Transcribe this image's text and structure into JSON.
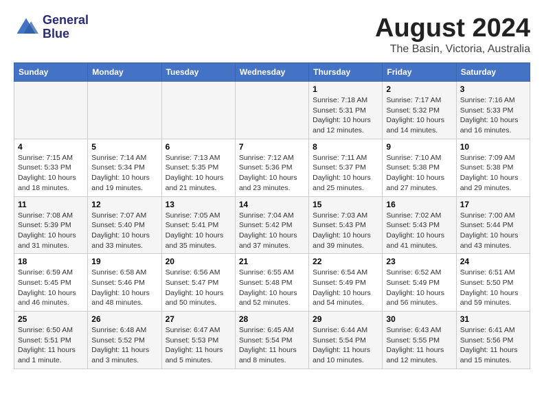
{
  "header": {
    "logo_line1": "General",
    "logo_line2": "Blue",
    "main_title": "August 2024",
    "subtitle": "The Basin, Victoria, Australia"
  },
  "columns": [
    "Sunday",
    "Monday",
    "Tuesday",
    "Wednesday",
    "Thursday",
    "Friday",
    "Saturday"
  ],
  "weeks": [
    [
      {
        "day": "",
        "info": ""
      },
      {
        "day": "",
        "info": ""
      },
      {
        "day": "",
        "info": ""
      },
      {
        "day": "",
        "info": ""
      },
      {
        "day": "1",
        "info": "Sunrise: 7:18 AM\nSunset: 5:31 PM\nDaylight: 10 hours\nand 12 minutes."
      },
      {
        "day": "2",
        "info": "Sunrise: 7:17 AM\nSunset: 5:32 PM\nDaylight: 10 hours\nand 14 minutes."
      },
      {
        "day": "3",
        "info": "Sunrise: 7:16 AM\nSunset: 5:33 PM\nDaylight: 10 hours\nand 16 minutes."
      }
    ],
    [
      {
        "day": "4",
        "info": "Sunrise: 7:15 AM\nSunset: 5:33 PM\nDaylight: 10 hours\nand 18 minutes."
      },
      {
        "day": "5",
        "info": "Sunrise: 7:14 AM\nSunset: 5:34 PM\nDaylight: 10 hours\nand 19 minutes."
      },
      {
        "day": "6",
        "info": "Sunrise: 7:13 AM\nSunset: 5:35 PM\nDaylight: 10 hours\nand 21 minutes."
      },
      {
        "day": "7",
        "info": "Sunrise: 7:12 AM\nSunset: 5:36 PM\nDaylight: 10 hours\nand 23 minutes."
      },
      {
        "day": "8",
        "info": "Sunrise: 7:11 AM\nSunset: 5:37 PM\nDaylight: 10 hours\nand 25 minutes."
      },
      {
        "day": "9",
        "info": "Sunrise: 7:10 AM\nSunset: 5:38 PM\nDaylight: 10 hours\nand 27 minutes."
      },
      {
        "day": "10",
        "info": "Sunrise: 7:09 AM\nSunset: 5:38 PM\nDaylight: 10 hours\nand 29 minutes."
      }
    ],
    [
      {
        "day": "11",
        "info": "Sunrise: 7:08 AM\nSunset: 5:39 PM\nDaylight: 10 hours\nand 31 minutes."
      },
      {
        "day": "12",
        "info": "Sunrise: 7:07 AM\nSunset: 5:40 PM\nDaylight: 10 hours\nand 33 minutes."
      },
      {
        "day": "13",
        "info": "Sunrise: 7:05 AM\nSunset: 5:41 PM\nDaylight: 10 hours\nand 35 minutes."
      },
      {
        "day": "14",
        "info": "Sunrise: 7:04 AM\nSunset: 5:42 PM\nDaylight: 10 hours\nand 37 minutes."
      },
      {
        "day": "15",
        "info": "Sunrise: 7:03 AM\nSunset: 5:43 PM\nDaylight: 10 hours\nand 39 minutes."
      },
      {
        "day": "16",
        "info": "Sunrise: 7:02 AM\nSunset: 5:43 PM\nDaylight: 10 hours\nand 41 minutes."
      },
      {
        "day": "17",
        "info": "Sunrise: 7:00 AM\nSunset: 5:44 PM\nDaylight: 10 hours\nand 43 minutes."
      }
    ],
    [
      {
        "day": "18",
        "info": "Sunrise: 6:59 AM\nSunset: 5:45 PM\nDaylight: 10 hours\nand 46 minutes."
      },
      {
        "day": "19",
        "info": "Sunrise: 6:58 AM\nSunset: 5:46 PM\nDaylight: 10 hours\nand 48 minutes."
      },
      {
        "day": "20",
        "info": "Sunrise: 6:56 AM\nSunset: 5:47 PM\nDaylight: 10 hours\nand 50 minutes."
      },
      {
        "day": "21",
        "info": "Sunrise: 6:55 AM\nSunset: 5:48 PM\nDaylight: 10 hours\nand 52 minutes."
      },
      {
        "day": "22",
        "info": "Sunrise: 6:54 AM\nSunset: 5:49 PM\nDaylight: 10 hours\nand 54 minutes."
      },
      {
        "day": "23",
        "info": "Sunrise: 6:52 AM\nSunset: 5:49 PM\nDaylight: 10 hours\nand 56 minutes."
      },
      {
        "day": "24",
        "info": "Sunrise: 6:51 AM\nSunset: 5:50 PM\nDaylight: 10 hours\nand 59 minutes."
      }
    ],
    [
      {
        "day": "25",
        "info": "Sunrise: 6:50 AM\nSunset: 5:51 PM\nDaylight: 11 hours\nand 1 minute."
      },
      {
        "day": "26",
        "info": "Sunrise: 6:48 AM\nSunset: 5:52 PM\nDaylight: 11 hours\nand 3 minutes."
      },
      {
        "day": "27",
        "info": "Sunrise: 6:47 AM\nSunset: 5:53 PM\nDaylight: 11 hours\nand 5 minutes."
      },
      {
        "day": "28",
        "info": "Sunrise: 6:45 AM\nSunset: 5:54 PM\nDaylight: 11 hours\nand 8 minutes."
      },
      {
        "day": "29",
        "info": "Sunrise: 6:44 AM\nSunset: 5:54 PM\nDaylight: 11 hours\nand 10 minutes."
      },
      {
        "day": "30",
        "info": "Sunrise: 6:43 AM\nSunset: 5:55 PM\nDaylight: 11 hours\nand 12 minutes."
      },
      {
        "day": "31",
        "info": "Sunrise: 6:41 AM\nSunset: 5:56 PM\nDaylight: 11 hours\nand 15 minutes."
      }
    ]
  ]
}
